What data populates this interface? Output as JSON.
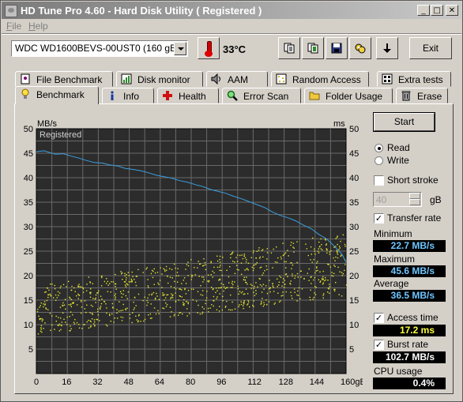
{
  "app": {
    "title": "HD Tune Pro 4.60 - Hard Disk Utility  ( Registered )"
  },
  "window_buttons": {
    "minimize": "_",
    "maximize": "□",
    "close": "✕"
  },
  "menu": [
    {
      "label": "File"
    },
    {
      "label": "Help"
    }
  ],
  "toolbar": {
    "drive": "WDC WD1600BEVS-00UST0   (160 gB)",
    "temperature": "33°C",
    "icons": [
      "copy-info-icon",
      "copy-screen-icon",
      "save-icon",
      "options-icon",
      "down-arrow-icon"
    ],
    "exit_label": "Exit"
  },
  "tabs_row1": [
    {
      "label": "File Benchmark",
      "icon": "file-benchmark-icon"
    },
    {
      "label": "Disk monitor",
      "icon": "disk-monitor-icon"
    },
    {
      "label": "AAM",
      "icon": "speaker-icon"
    },
    {
      "label": "Random Access",
      "icon": "random-access-icon"
    },
    {
      "label": "Extra tests",
      "icon": "extra-tests-icon"
    }
  ],
  "tabs_row2": [
    {
      "label": "Benchmark",
      "icon": "lightbulb-icon",
      "active": true
    },
    {
      "label": "Info",
      "icon": "info-icon"
    },
    {
      "label": "Health",
      "icon": "health-cross-icon"
    },
    {
      "label": "Error Scan",
      "icon": "magnifier-icon"
    },
    {
      "label": "Folder Usage",
      "icon": "folder-icon"
    },
    {
      "label": "Erase",
      "icon": "trash-icon"
    }
  ],
  "controls": {
    "start_label": "Start",
    "read_label": "Read",
    "write_label": "Write",
    "mode": "Read",
    "short_stroke_label": "Short stroke",
    "short_stroke_checked": false,
    "short_stroke_value": "40",
    "short_stroke_unit": "gB",
    "transfer_rate_label": "Transfer rate",
    "transfer_rate_checked": true,
    "minimum_label": "Minimum",
    "minimum_value": "22.7 MB/s",
    "maximum_label": "Maximum",
    "maximum_value": "45.6 MB/s",
    "average_label": "Average",
    "average_value": "36.5 MB/s",
    "access_time_label": "Access time",
    "access_time_checked": true,
    "access_time_value": "17.2 ms",
    "burst_rate_label": "Burst rate",
    "burst_rate_checked": true,
    "burst_rate_value": "102.7 MB/s",
    "cpu_usage_label": "CPU usage",
    "cpu_usage_value": "0.4%"
  },
  "colors": {
    "plot_bg": "#2c2c2c",
    "grid": "#6a6a6a",
    "transfer_line": "#3aa0e0",
    "access_dots": "#e6e632"
  },
  "chart_data": {
    "type": "line",
    "watermark": "Registered",
    "y_left_label": "MB/s",
    "y_right_label": "ms",
    "xlabel_unit": "gB",
    "x_ticks": [
      "0",
      "16",
      "32",
      "48",
      "64",
      "80",
      "96",
      "112",
      "128",
      "144",
      "160gB"
    ],
    "y_ticks": [
      5,
      10,
      15,
      20,
      25,
      30,
      35,
      40,
      45,
      50
    ],
    "xlim": [
      0,
      160
    ],
    "ylim": [
      0,
      50
    ],
    "grid": true,
    "series": [
      {
        "name": "Transfer rate",
        "axis": "left",
        "x": [
          0,
          4,
          8,
          10,
          14,
          18,
          22,
          26,
          30,
          34,
          38,
          42,
          46,
          50,
          54,
          58,
          62,
          66,
          70,
          74,
          78,
          82,
          86,
          90,
          94,
          98,
          102,
          106,
          110,
          114,
          118,
          122,
          126,
          130,
          134,
          138,
          142,
          146,
          150,
          154,
          158,
          160
        ],
        "y": [
          45.3,
          45.5,
          45.0,
          44.8,
          44.9,
          44.4,
          44.0,
          43.5,
          43.1,
          43.0,
          42.6,
          42.4,
          41.9,
          41.7,
          41.4,
          41.0,
          40.5,
          40.2,
          39.9,
          39.4,
          39.1,
          38.6,
          38.2,
          37.6,
          37.2,
          36.8,
          36.2,
          35.7,
          35.1,
          34.5,
          33.9,
          33.0,
          32.3,
          31.8,
          31.2,
          30.3,
          29.6,
          28.4,
          27.5,
          26.0,
          24.3,
          22.7
        ]
      }
    ],
    "access_time": {
      "name": "Access time",
      "axis": "right",
      "unit": "ms",
      "band_start": [
        8,
        18
      ],
      "band_end": [
        16,
        29
      ],
      "samples": 900,
      "average": 17.2
    }
  }
}
